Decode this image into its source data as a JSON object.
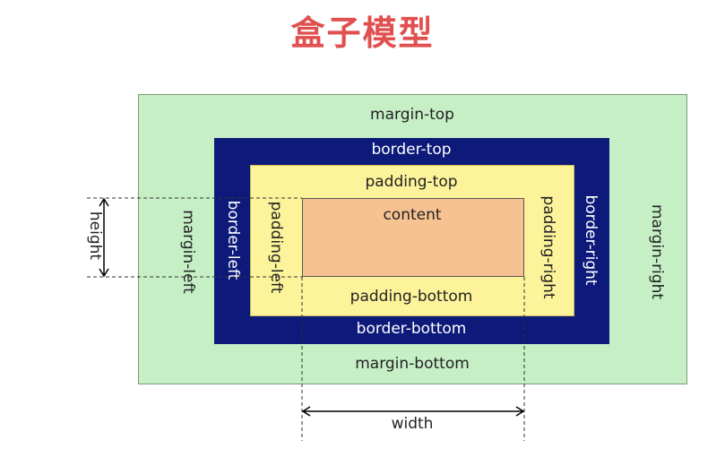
{
  "title": "盒子模型",
  "labels": {
    "margin_top": "margin-top",
    "margin_bottom": "margin-bottom",
    "margin_left": "margin-left",
    "margin_right": "margin-right",
    "border_top": "border-top",
    "border_bottom": "border-bottom",
    "border_left": "border-left",
    "border_right": "border-right",
    "padding_top": "padding-top",
    "padding_bottom": "padding-bottom",
    "padding_left": "padding-left",
    "padding_right": "padding-right",
    "content": "content",
    "height": "height",
    "width": "width"
  },
  "colors": {
    "title": "#e0504f",
    "margin": "#c6efc6",
    "border": "#0d1a7a",
    "padding": "#fdf39a",
    "content": "#f7c291"
  }
}
